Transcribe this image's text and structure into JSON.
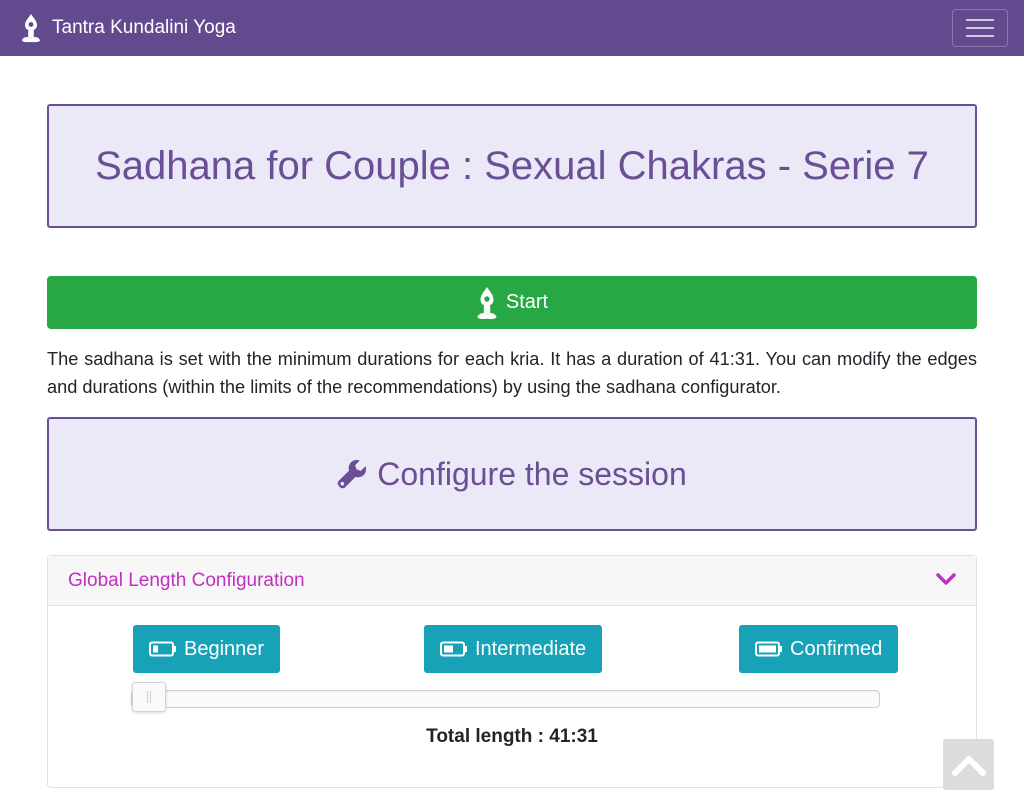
{
  "navbar": {
    "brand": "Tantra Kundalini Yoga",
    "logo_icon": "meditating-figure-icon",
    "toggler_icon": "hamburger-menu-icon",
    "background": "#634a8f"
  },
  "page": {
    "title": "Sadhana for Couple : Sexual Chakras - Serie 7"
  },
  "start_button": {
    "label": "Start",
    "icon": "meditating-figure-icon",
    "color": "#28a745"
  },
  "description": "The sadhana is set with the minimum durations for each kria. It has a duration of 41:31. You can modify the edges and durations (within the limits of the recommendations) by using the sadhana configurator.",
  "configure": {
    "label": "Configure the session",
    "icon": "wrench-icon"
  },
  "global_config": {
    "title": "Global Length Configuration",
    "toggle_icon": "chevron-down-icon",
    "levels": [
      {
        "label": "Beginner",
        "icon": "battery-low-icon"
      },
      {
        "label": "Intermediate",
        "icon": "battery-half-icon"
      },
      {
        "label": "Confirmed",
        "icon": "battery-full-icon"
      }
    ],
    "slider_value": 0,
    "total_length": "Total length : 41:31"
  },
  "scroll_top": {
    "icon": "chevron-up-icon"
  },
  "colors": {
    "accent_purple": "#6a4f95",
    "panel_lavender": "#ebe8f7",
    "header_magenta": "#c12fc1",
    "level_button_teal": "#17a2b8"
  }
}
